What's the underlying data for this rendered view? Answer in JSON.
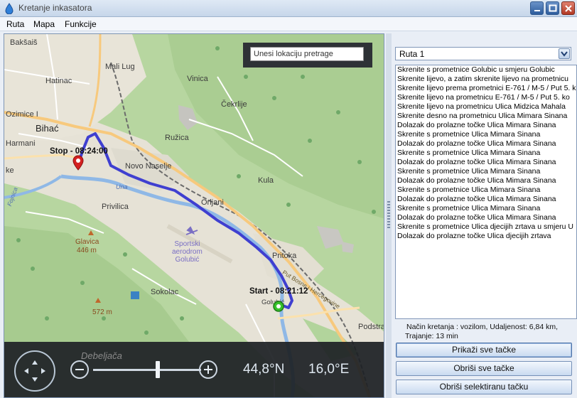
{
  "window": {
    "title": "Kretanje inkasatora"
  },
  "menu": {
    "items": [
      "Ruta",
      "Mapa",
      "Funkcije"
    ]
  },
  "map": {
    "search_placeholder": "Unesi lokaciju pretrage",
    "places": {
      "baksais": "Bakšaiš",
      "mali_lug": "Mali Lug",
      "hatinac": "Hatinac",
      "vinica": "Vinica",
      "cekrlije": "Čekrlije",
      "ozimice": "Ozimice I",
      "bihac": "Bihać",
      "harmani": "Harmani",
      "ruzica": "Ružica",
      "novo_naselje": "Novo Naselje",
      "kula": "Kula",
      "orljani": "Orljani",
      "privilica": "Privilica",
      "sportski": "Sportski\naerodrom\nGolubić",
      "glavica": "Glavica",
      "glavica_elev": "446 m",
      "pritoka": "Pritoka",
      "sokolac": "Sokolac",
      "elev_572": "572 m",
      "golubic": "Golubić",
      "podstrana": "Podstra",
      "debeljaca": "Debeljača",
      "una": "Una",
      "ulica_hercegovine": "Put Bosne i Hercegovine",
      "fojnica": "Fojnica",
      "ke": "ke"
    },
    "stop_label": "Stop - 08:24:00",
    "start_label": "Start - 08:21:12",
    "lat": "44,8°N",
    "lon": "16,0°E",
    "zoom_level": 0.6
  },
  "panel": {
    "route_selected": "Ruta 1",
    "steps": [
      "Skrenite s prometnice Golubic u smjeru Golubic",
      "Skrenite lijevo, a zatim skrenite lijevo na prometnicu",
      "Skrenite lijevo prema prometnici E-761 / M-5 / Put 5. k",
      "Skrenite lijevo na prometnicu E-761 / M-5 / Put 5. ko",
      "Skrenite lijevo na prometnicu Ulica Midzica Mahala",
      "Skrenite desno na prometnicu Ulica Mimara Sinana",
      "Dolazak do prolazne točke Ulica Mimara Sinana",
      "Skrenite s prometnice  Ulica Mimara Sinana",
      "Dolazak do prolazne točke Ulica Mimara Sinana",
      "Skrenite s prometnice  Ulica Mimara Sinana",
      "Dolazak do prolazne točke Ulica Mimara Sinana",
      "Skrenite s prometnice  Ulica Mimara Sinana",
      "Dolazak do prolazne točke Ulica Mimara Sinana",
      "Skrenite s prometnice  Ulica Mimara Sinana",
      "Dolazak do prolazne točke Ulica Mimara Sinana",
      "Skrenite s prometnice  Ulica Mimara Sinana",
      "Dolazak do prolazne točke Ulica Mimara Sinana",
      "Skrenite s prometnice Ulica djecijih zrtava u smjeru U",
      "Dolazak do prolazne točke Ulica djecijih zrtava"
    ],
    "summary_line1": "Način kretanja : vozilom, Udaljenost: 6,84 km,",
    "summary_line2": "Trajanje: 13 min",
    "btn_show_all": "Prikaži sve tačke",
    "btn_delete_all": "Obriši sve tačke",
    "btn_delete_selected": "Obriši selektiranu tačku"
  },
  "colors": {
    "route": "#3f3fd0",
    "stop_marker": "#d42020",
    "start_marker": "#36c22a"
  }
}
